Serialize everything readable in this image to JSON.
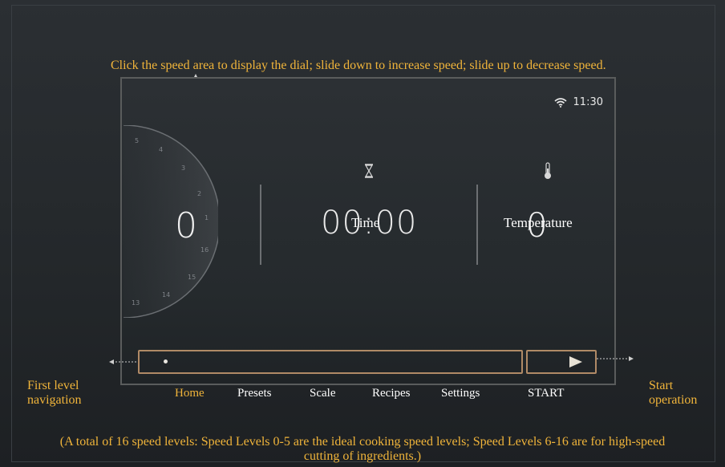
{
  "status_bar": {
    "time": "11:30",
    "wifi_icon": "wifi-icon"
  },
  "speed": {
    "value": "0",
    "dial_ticks": [
      "0",
      "1",
      "2",
      "3",
      "4",
      "5",
      "16",
      "15",
      "14",
      "13"
    ]
  },
  "time": {
    "value": "00:00",
    "label": "Time",
    "icon": "hourglass-icon"
  },
  "temperature": {
    "value": "0",
    "label": "Temperature",
    "icon": "thermometer-icon"
  },
  "nav": {
    "items": [
      {
        "label": "Home",
        "active": true
      },
      {
        "label": "Presets"
      },
      {
        "label": "Scale"
      },
      {
        "label": "Recipes"
      },
      {
        "label": "Settings"
      },
      {
        "label": "START"
      }
    ]
  },
  "annotations": {
    "speed_hint": "Click the speed area to display the dial; slide down to increase speed; slide up to decrease speed.",
    "first_level": "First level navigation",
    "start_operation": "Start operation",
    "speed_levels_note": "(A total of 16 speed levels: Speed Levels 0-5 are the ideal cooking speed levels; Speed Levels 6-16 are for high-speed cutting of ingredients.)"
  },
  "colors": {
    "accent": "#f0b43a",
    "frame": "#b08a66"
  }
}
